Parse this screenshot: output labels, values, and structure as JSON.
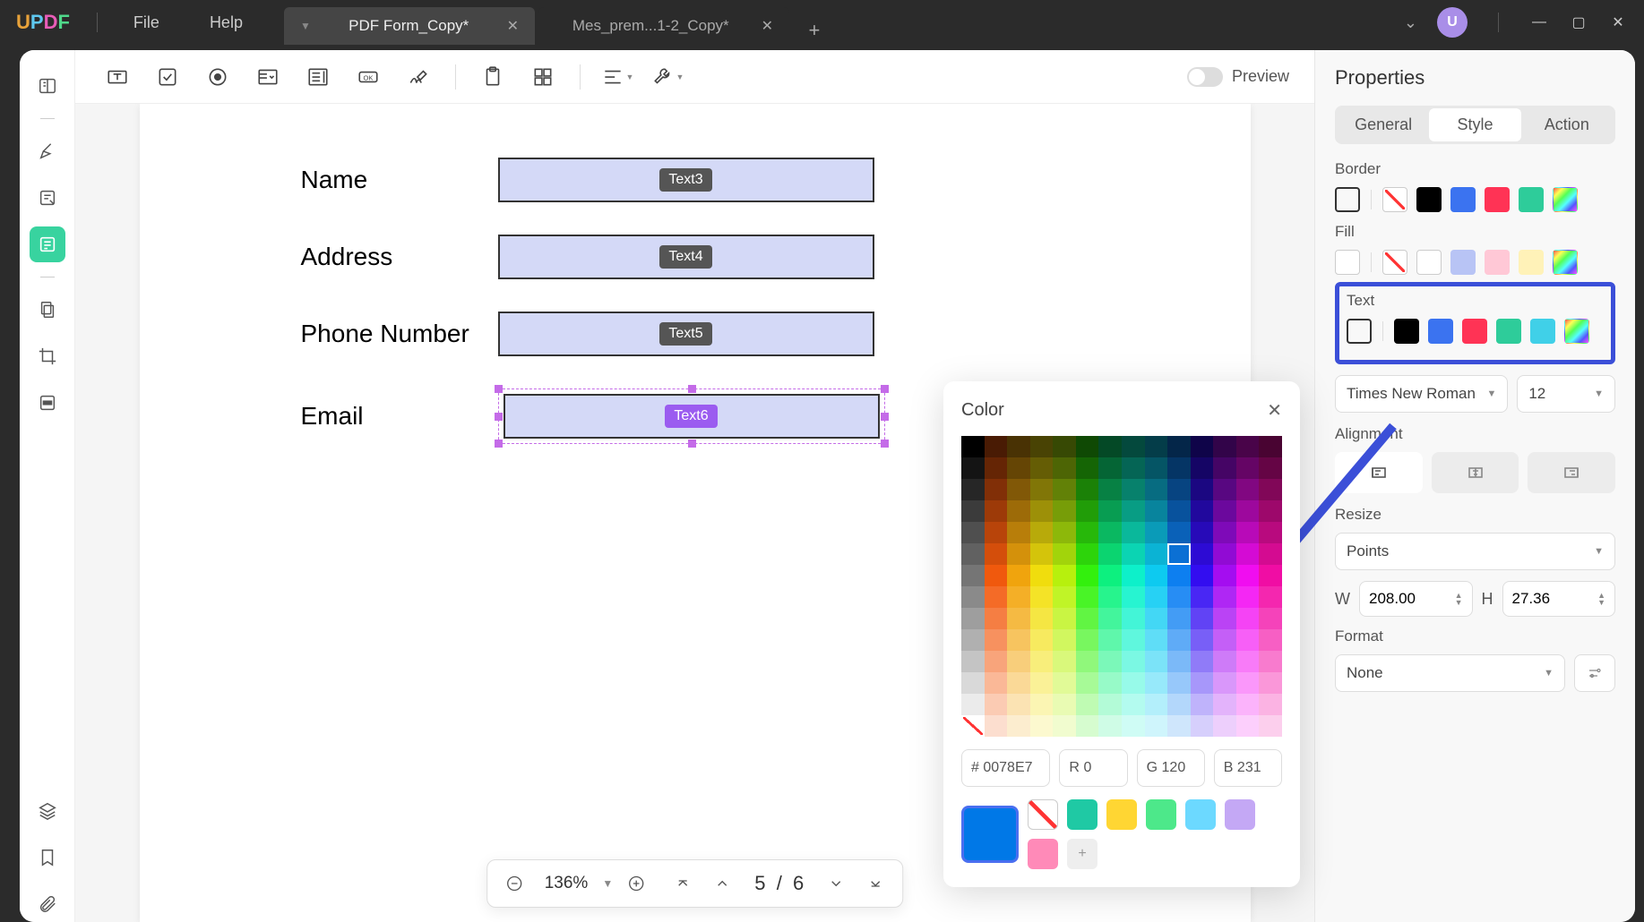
{
  "app": {
    "logo": "UPDF"
  },
  "menu": {
    "file": "File",
    "help": "Help"
  },
  "tabs": [
    {
      "title": "PDF Form_Copy*",
      "active": true
    },
    {
      "title": "Mes_prem...1-2_Copy*",
      "active": false
    }
  ],
  "avatar_letter": "U",
  "preview_label": "Preview",
  "form": {
    "rows": [
      {
        "label": "Name",
        "tag": "Text3",
        "selected": false
      },
      {
        "label": "Address",
        "tag": "Text4",
        "selected": false
      },
      {
        "label": "Phone Number",
        "tag": "Text5",
        "selected": false
      },
      {
        "label": "Email",
        "tag": "Text6",
        "selected": true
      }
    ]
  },
  "zoom": {
    "value": "136%",
    "page_current": "5",
    "page_sep": "/",
    "page_total": "6"
  },
  "properties": {
    "title": "Properties",
    "tabs": {
      "general": "General",
      "style": "Style",
      "action": "Action"
    },
    "border_label": "Border",
    "fill_label": "Fill",
    "text_label": "Text",
    "font": "Times New Roman",
    "font_size": "12",
    "alignment_label": "Alignment",
    "resize_label": "Resize",
    "resize_unit": "Points",
    "w_label": "W",
    "w_value": "208.00",
    "h_label": "H",
    "h_value": "27.36",
    "format_label": "Format",
    "format_value": "None",
    "border_colors": [
      "#000000",
      "#3b73f0",
      "#ff3355",
      "#2ecc9a",
      "gradient"
    ],
    "fill_colors": [
      "#ffffff",
      "#b8c4f5",
      "#ffc8d6",
      "#fff2b8",
      "gradient"
    ],
    "text_colors": [
      "#000000",
      "#3b73f0",
      "#ff3355",
      "#2ecc9a",
      "#40d0e8",
      "gradient"
    ]
  },
  "color_picker": {
    "title": "Color",
    "hex_prefix": "#",
    "hex": "0078E7",
    "r_label": "R",
    "r": "0",
    "g_label": "G",
    "g": "120",
    "b_label": "B",
    "b": "231",
    "current": "#0078e7",
    "recent": [
      "#1fc9a4",
      "#ffd633",
      "#4de88a",
      "#6cd9ff",
      "#c4a8f5",
      "#ff8ab8",
      "#dcdcdc"
    ]
  },
  "chart_data": null
}
